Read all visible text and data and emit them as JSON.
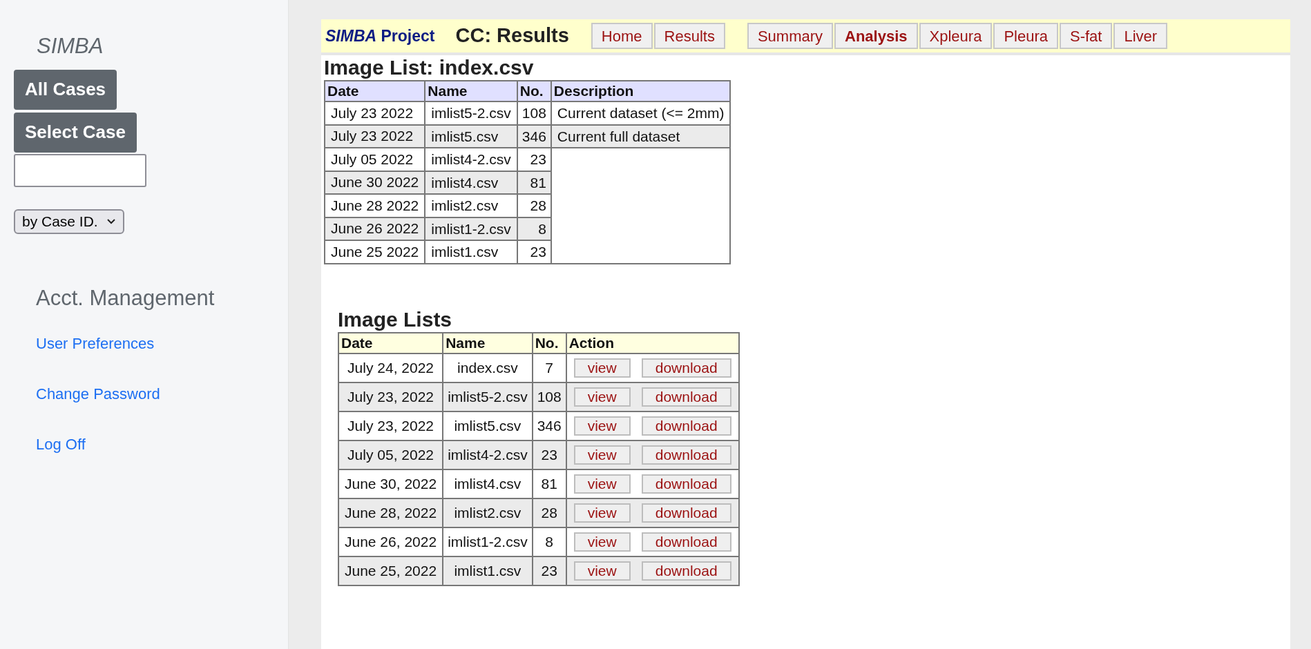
{
  "sidebar": {
    "title": "SIMBA",
    "buttons": [
      "All Cases",
      "Select Case"
    ],
    "sort_select": {
      "value": "by Case ID."
    },
    "section_title": "Acct. Management",
    "links": [
      "User Preferences",
      "Change Password",
      "Log Off"
    ]
  },
  "header": {
    "brand": "*SIMBA* Project",
    "page_title": "CC: Results",
    "tab_groups": [
      [
        {
          "label": "Home",
          "selected": false
        },
        {
          "label": "Results",
          "selected": false
        }
      ],
      [
        {
          "label": "Summary",
          "selected": false
        },
        {
          "label": "Analysis",
          "selected": true
        },
        {
          "label": "Xpleura",
          "selected": false
        },
        {
          "label": "Pleura",
          "selected": false
        },
        {
          "label": "S-fat",
          "selected": false
        },
        {
          "label": "Liver",
          "selected": false
        }
      ]
    ]
  },
  "image_list": {
    "title": "Image List: index.csv",
    "columns": [
      "Date",
      "Name",
      "No.",
      "Description"
    ],
    "rows": [
      {
        "date": "July 23 2022",
        "name": "imlist5-2.csv",
        "count": "108",
        "description": "Current dataset (<= 2mm)"
      },
      {
        "date": "July 23 2022",
        "name": "imlist5.csv",
        "count": "346",
        "description": "Current full dataset"
      },
      {
        "date": "July 05 2022",
        "name": "imlist4-2.csv",
        "count": "23"
      },
      {
        "date": "June 30 2022",
        "name": "imlist4.csv",
        "count": "81"
      },
      {
        "date": "June 28 2022",
        "name": "imlist2.csv",
        "count": "28"
      },
      {
        "date": "June 26 2022",
        "name": "imlist1-2.csv",
        "count": "8"
      },
      {
        "date": "June 25 2022",
        "name": "imlist1.csv",
        "count": "23"
      }
    ]
  },
  "image_lists": {
    "title": "Image Lists",
    "columns": [
      "Date",
      "Name",
      "No.",
      "Action"
    ],
    "rows": [
      {
        "date": "July 24, 2022",
        "name": "index.csv",
        "count": "7",
        "actions": [
          "view",
          "download"
        ]
      },
      {
        "date": "July 23, 2022",
        "name": "imlist5-2.csv",
        "count": "108",
        "actions": [
          "view",
          "download"
        ]
      },
      {
        "date": "July 23, 2022",
        "name": "imlist5.csv",
        "count": "346",
        "actions": [
          "view",
          "download"
        ]
      },
      {
        "date": "July 05, 2022",
        "name": "imlist4-2.csv",
        "count": "23",
        "actions": [
          "view",
          "download"
        ]
      },
      {
        "date": "June 30, 2022",
        "name": "imlist4.csv",
        "count": "81",
        "actions": [
          "view",
          "download"
        ]
      },
      {
        "date": "June 28, 2022",
        "name": "imlist2.csv",
        "count": "28",
        "actions": [
          "view",
          "download"
        ]
      },
      {
        "date": "June 26, 2022",
        "name": "imlist1-2.csv",
        "count": "8",
        "actions": [
          "view",
          "download"
        ]
      },
      {
        "date": "June 25, 2022",
        "name": "imlist1.csv",
        "count": "23",
        "actions": [
          "view",
          "download"
        ]
      }
    ]
  }
}
